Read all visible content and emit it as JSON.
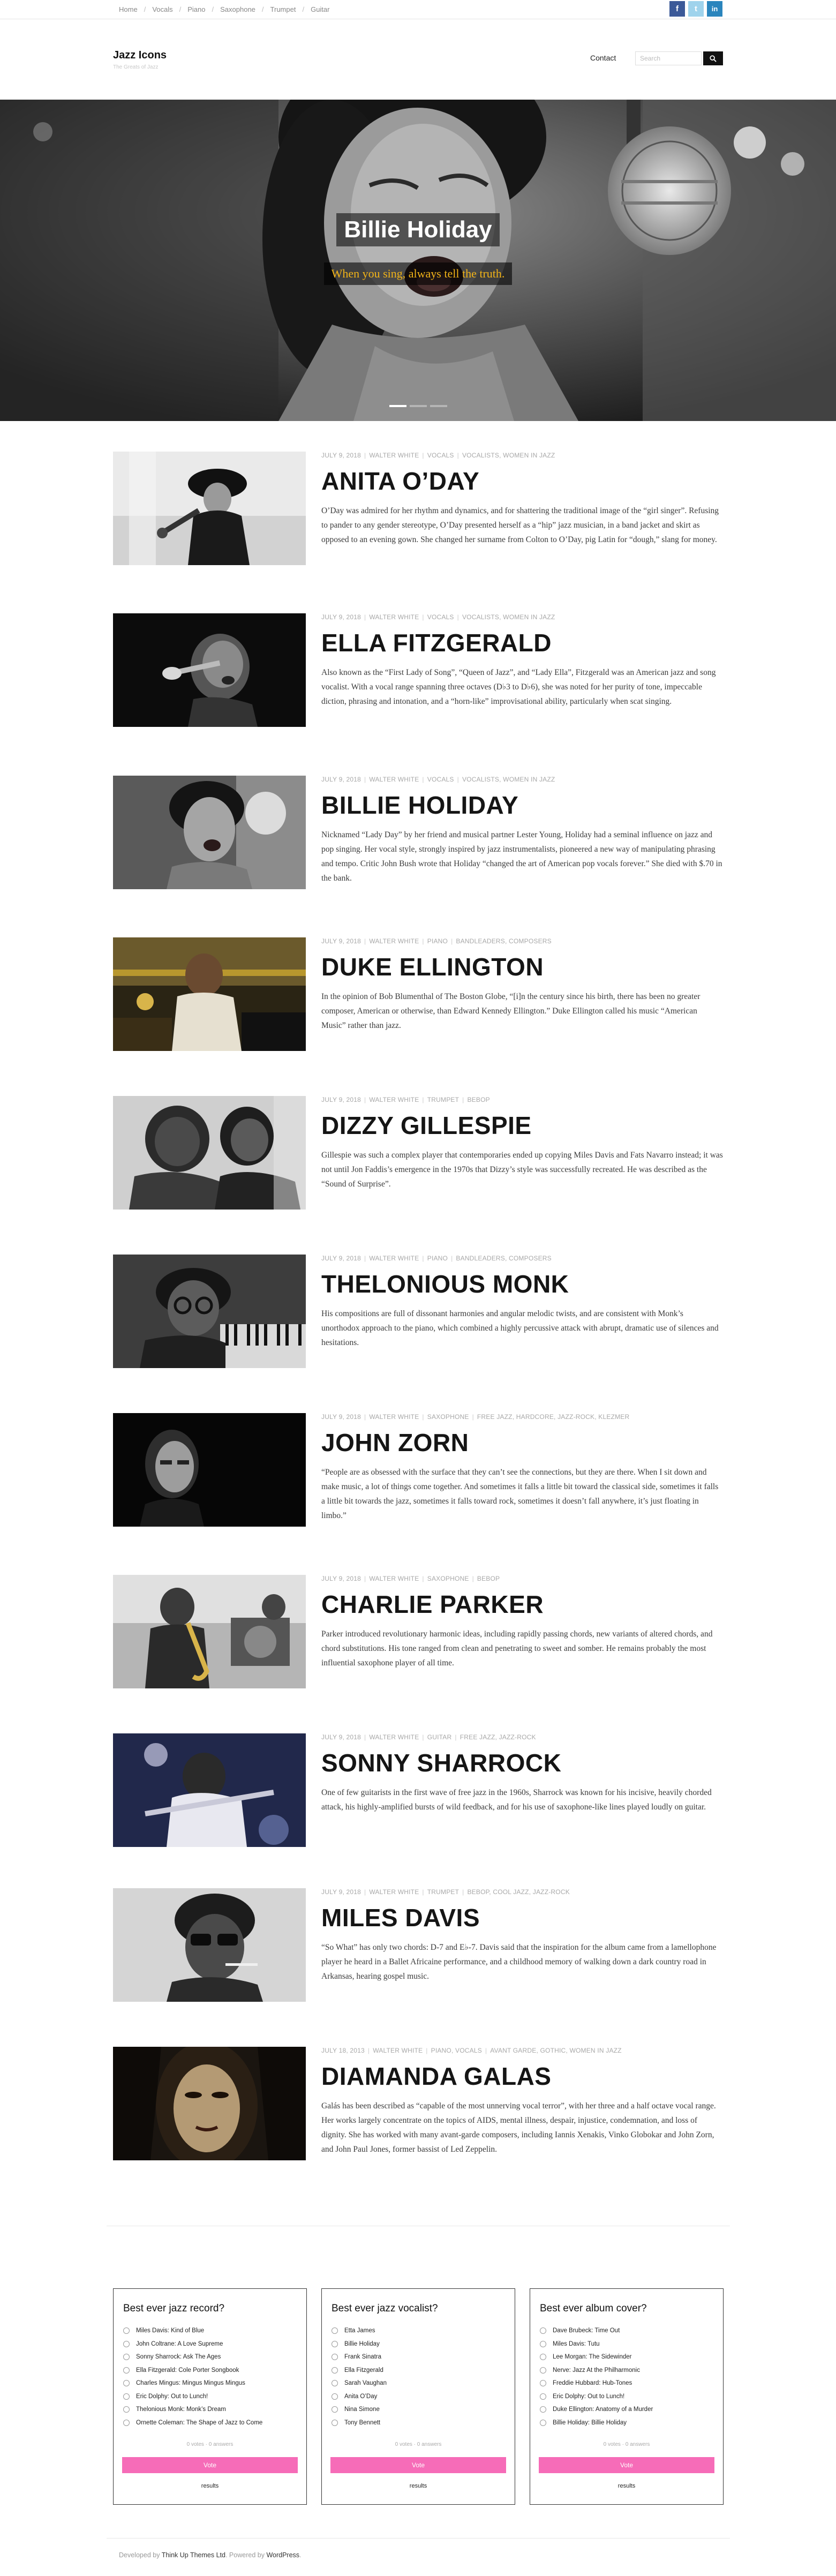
{
  "top_nav": [
    "Home",
    "Vocals",
    "Piano",
    "Saxophone",
    "Trumpet",
    "Guitar"
  ],
  "social": [
    {
      "icon": "facebook-icon",
      "glyph": "f",
      "color": "#3b5998"
    },
    {
      "icon": "twitter-icon",
      "glyph": "t",
      "color": "#9fd3ec"
    },
    {
      "icon": "linkedin-icon",
      "glyph": "in",
      "color": "#2a85bd"
    }
  ],
  "site": {
    "title": "Jazz Icons",
    "tagline": "The Greats of Jazz"
  },
  "menu": {
    "contact": "Contact"
  },
  "search": {
    "placeholder": "Search"
  },
  "hero": {
    "title": "Billie Holiday",
    "quote": "When you sing, always tell the truth.",
    "slide_count": 3,
    "active_slide": 0
  },
  "posts": [
    {
      "meta": [
        "JULY 9, 2018",
        "WALTER WHITE",
        "VOCALS",
        "VOCALISTS, WOMEN IN JAZZ"
      ],
      "title": "ANITA O’DAY",
      "excerpt": "O’Day was admired for her rhythm and dynamics, and for shattering the traditional image of the “girl singer”. Refusing to pander to any gender stereotype, O’Day presented herself as a “hip” jazz musician, in a band jacket and skirt as opposed to an evening gown. She changed her surname from Colton to O’Day, pig Latin for “dough,” slang for money."
    },
    {
      "meta": [
        "JULY 9, 2018",
        "WALTER WHITE",
        "VOCALS",
        "VOCALISTS, WOMEN IN JAZZ"
      ],
      "title": "ELLA FITZGERALD",
      "excerpt": "Also known as the “First Lady of Song”, “Queen of Jazz”, and “Lady Ella”, Fitzgerald was an American jazz and song vocalist. With a vocal range spanning three octaves (D♭3 to D♭6), she was noted for her purity of tone, impeccable diction, phrasing and intonation, and a “horn-like” improvisational ability, particularly when scat singing."
    },
    {
      "meta": [
        "JULY 9, 2018",
        "WALTER WHITE",
        "VOCALS",
        "VOCALISTS, WOMEN IN JAZZ"
      ],
      "title": "BILLIE HOLIDAY",
      "excerpt": "Nicknamed “Lady Day” by her friend and musical partner Lester Young, Holiday had a seminal influence on jazz and pop singing. Her vocal style, strongly inspired by jazz instrumentalists, pioneered a new way of manipulating phrasing and tempo. Critic John Bush wrote that Holiday “changed the art of American pop vocals forever.” She died with $.70 in the bank."
    },
    {
      "meta": [
        "JULY 9, 2018",
        "WALTER WHITE",
        "PIANO",
        "BANDLEADERS, COMPOSERS"
      ],
      "title": "DUKE ELLINGTON",
      "excerpt": "In the opinion of Bob Blumenthal of The Boston Globe, “[i]n the century since his birth, there has been no greater composer, American or otherwise, than Edward Kennedy Ellington.” Duke Ellington called his music “American Music” rather than jazz."
    },
    {
      "meta": [
        "JULY 9, 2018",
        "WALTER WHITE",
        "TRUMPET",
        "BEBOP"
      ],
      "title": "DIZZY GILLESPIE",
      "excerpt": "Gillespie was such a complex player that contemporaries ended up copying Miles Davis and Fats Navarro instead; it was not until Jon Faddis’s emergence in the 1970s that Dizzy’s style was successfully recreated. He was described as the “Sound of Surprise”."
    },
    {
      "meta": [
        "JULY 9, 2018",
        "WALTER WHITE",
        "PIANO",
        "BANDLEADERS, COMPOSERS"
      ],
      "title": "THELONIOUS MONK",
      "excerpt": "His compositions are full of dissonant harmonies and angular melodic twists, and are consistent with Monk’s unorthodox approach to the piano, which combined a highly percussive attack with abrupt, dramatic use of silences and hesitations."
    },
    {
      "meta": [
        "JULY 9, 2018",
        "WALTER WHITE",
        "SAXOPHONE",
        "FREE JAZZ, HARDCORE, JAZZ-ROCK, KLEZMER"
      ],
      "title": "JOHN ZORN",
      "excerpt": "“People are as obsessed with the surface that they can’t see the connections, but they are there. When I sit down and make music, a lot of things come together. And sometimes it falls a little bit toward the classical side, sometimes it falls a little bit towards the jazz, sometimes it falls toward rock, sometimes it doesn’t fall anywhere, it’s just floating in limbo.”"
    },
    {
      "meta": [
        "JULY 9, 2018",
        "WALTER WHITE",
        "SAXOPHONE",
        "BEBOP"
      ],
      "title": "CHARLIE PARKER",
      "excerpt": "Parker introduced revolutionary harmonic ideas, including rapidly passing chords, new variants of altered chords, and chord substitutions. His tone ranged from clean and penetrating to sweet and somber. He remains probably the most influential saxophone player of all time."
    },
    {
      "meta": [
        "JULY 9, 2018",
        "WALTER WHITE",
        "GUITAR",
        "FREE JAZZ, JAZZ-ROCK"
      ],
      "title": "SONNY SHARROCK",
      "excerpt": "One of few guitarists in the first wave of free jazz in the 1960s, Sharrock was known for his incisive, heavily chorded attack, his highly-amplified bursts of wild feedback, and for his use of saxophone-like lines played loudly on guitar."
    },
    {
      "meta": [
        "JULY 9, 2018",
        "WALTER WHITE",
        "TRUMPET",
        "BEBOP, COOL JAZZ, JAZZ-ROCK"
      ],
      "title": "MILES DAVIS",
      "excerpt": "“So What” has only two chords: D-7 and E♭-7. Davis said that the inspiration for the album came from a lamellophone player he heard in a Ballet Africaine performance, and a childhood memory of walking down a dark country road in Arkansas, hearing gospel music."
    },
    {
      "meta": [
        "JULY 18, 2013",
        "WALTER WHITE",
        "PIANO, VOCALS",
        "AVANT GARDE, GOTHIC, WOMEN IN JAZZ"
      ],
      "title": "DIAMANDA GALAS",
      "excerpt": "Galás has been described as “capable of the most unnerving vocal terror”, with her three and a half octave vocal range. Her works largely concentrate on the topics of AIDS, mental illness, despair, injustice, condemnation, and loss of dignity. She has worked with many avant-garde composers, including Iannis Xenakis, Vinko Globokar and John Zorn, and John Paul Jones, former bassist of Led Zeppelin."
    }
  ],
  "polls": [
    {
      "question": "Best ever jazz record?",
      "options": [
        "Miles Davis: Kind of Blue",
        "John Coltrane: A Love Supreme",
        "Sonny Sharrock: Ask The Ages",
        "Ella Fitzgerald: Cole Porter Songbook",
        "Charles Mingus: Mingus Mingus Mingus",
        "Eric Dolphy: Out to Lunch!",
        "Thelonious Monk: Monk’s Dream",
        "Ornette Coleman: The Shape of Jazz to Come"
      ],
      "votes": "0 votes · 0 answers",
      "vote_label": "Vote",
      "results_label": "results"
    },
    {
      "question": "Best ever jazz vocalist?",
      "options": [
        "Etta James",
        "Billie Holiday",
        "Frank Sinatra",
        "Ella Fitzgerald",
        "Sarah Vaughan",
        "Anita O’Day",
        "Nina Simone",
        "Tony Bennett"
      ],
      "votes": "0 votes · 0 answers",
      "vote_label": "Vote",
      "results_label": "results"
    },
    {
      "question": "Best ever album cover?",
      "options": [
        "Dave Brubeck: Time Out",
        "Miles Davis: Tutu",
        "Lee Morgan: The Sidewinder",
        "Nerve: Jazz At the Philharmonic",
        "Freddie Hubbard: Hub-Tones",
        "Eric Dolphy: Out to Lunch!",
        "Duke Ellington: Anatomy of a Murder",
        "Billie Holiday: Billie Holiday"
      ],
      "votes": "0 votes · 0 answers",
      "vote_label": "Vote",
      "results_label": "results"
    }
  ],
  "footer": {
    "developed_by": "Developed by",
    "theme_link": "Think Up Themes Ltd",
    "powered_by": ". Powered by",
    "wp_link": "WordPress",
    "end": "."
  },
  "colors": {
    "vote_button": "#f66cb8",
    "hero_quote": "#f2b418",
    "title": "#151515"
  }
}
